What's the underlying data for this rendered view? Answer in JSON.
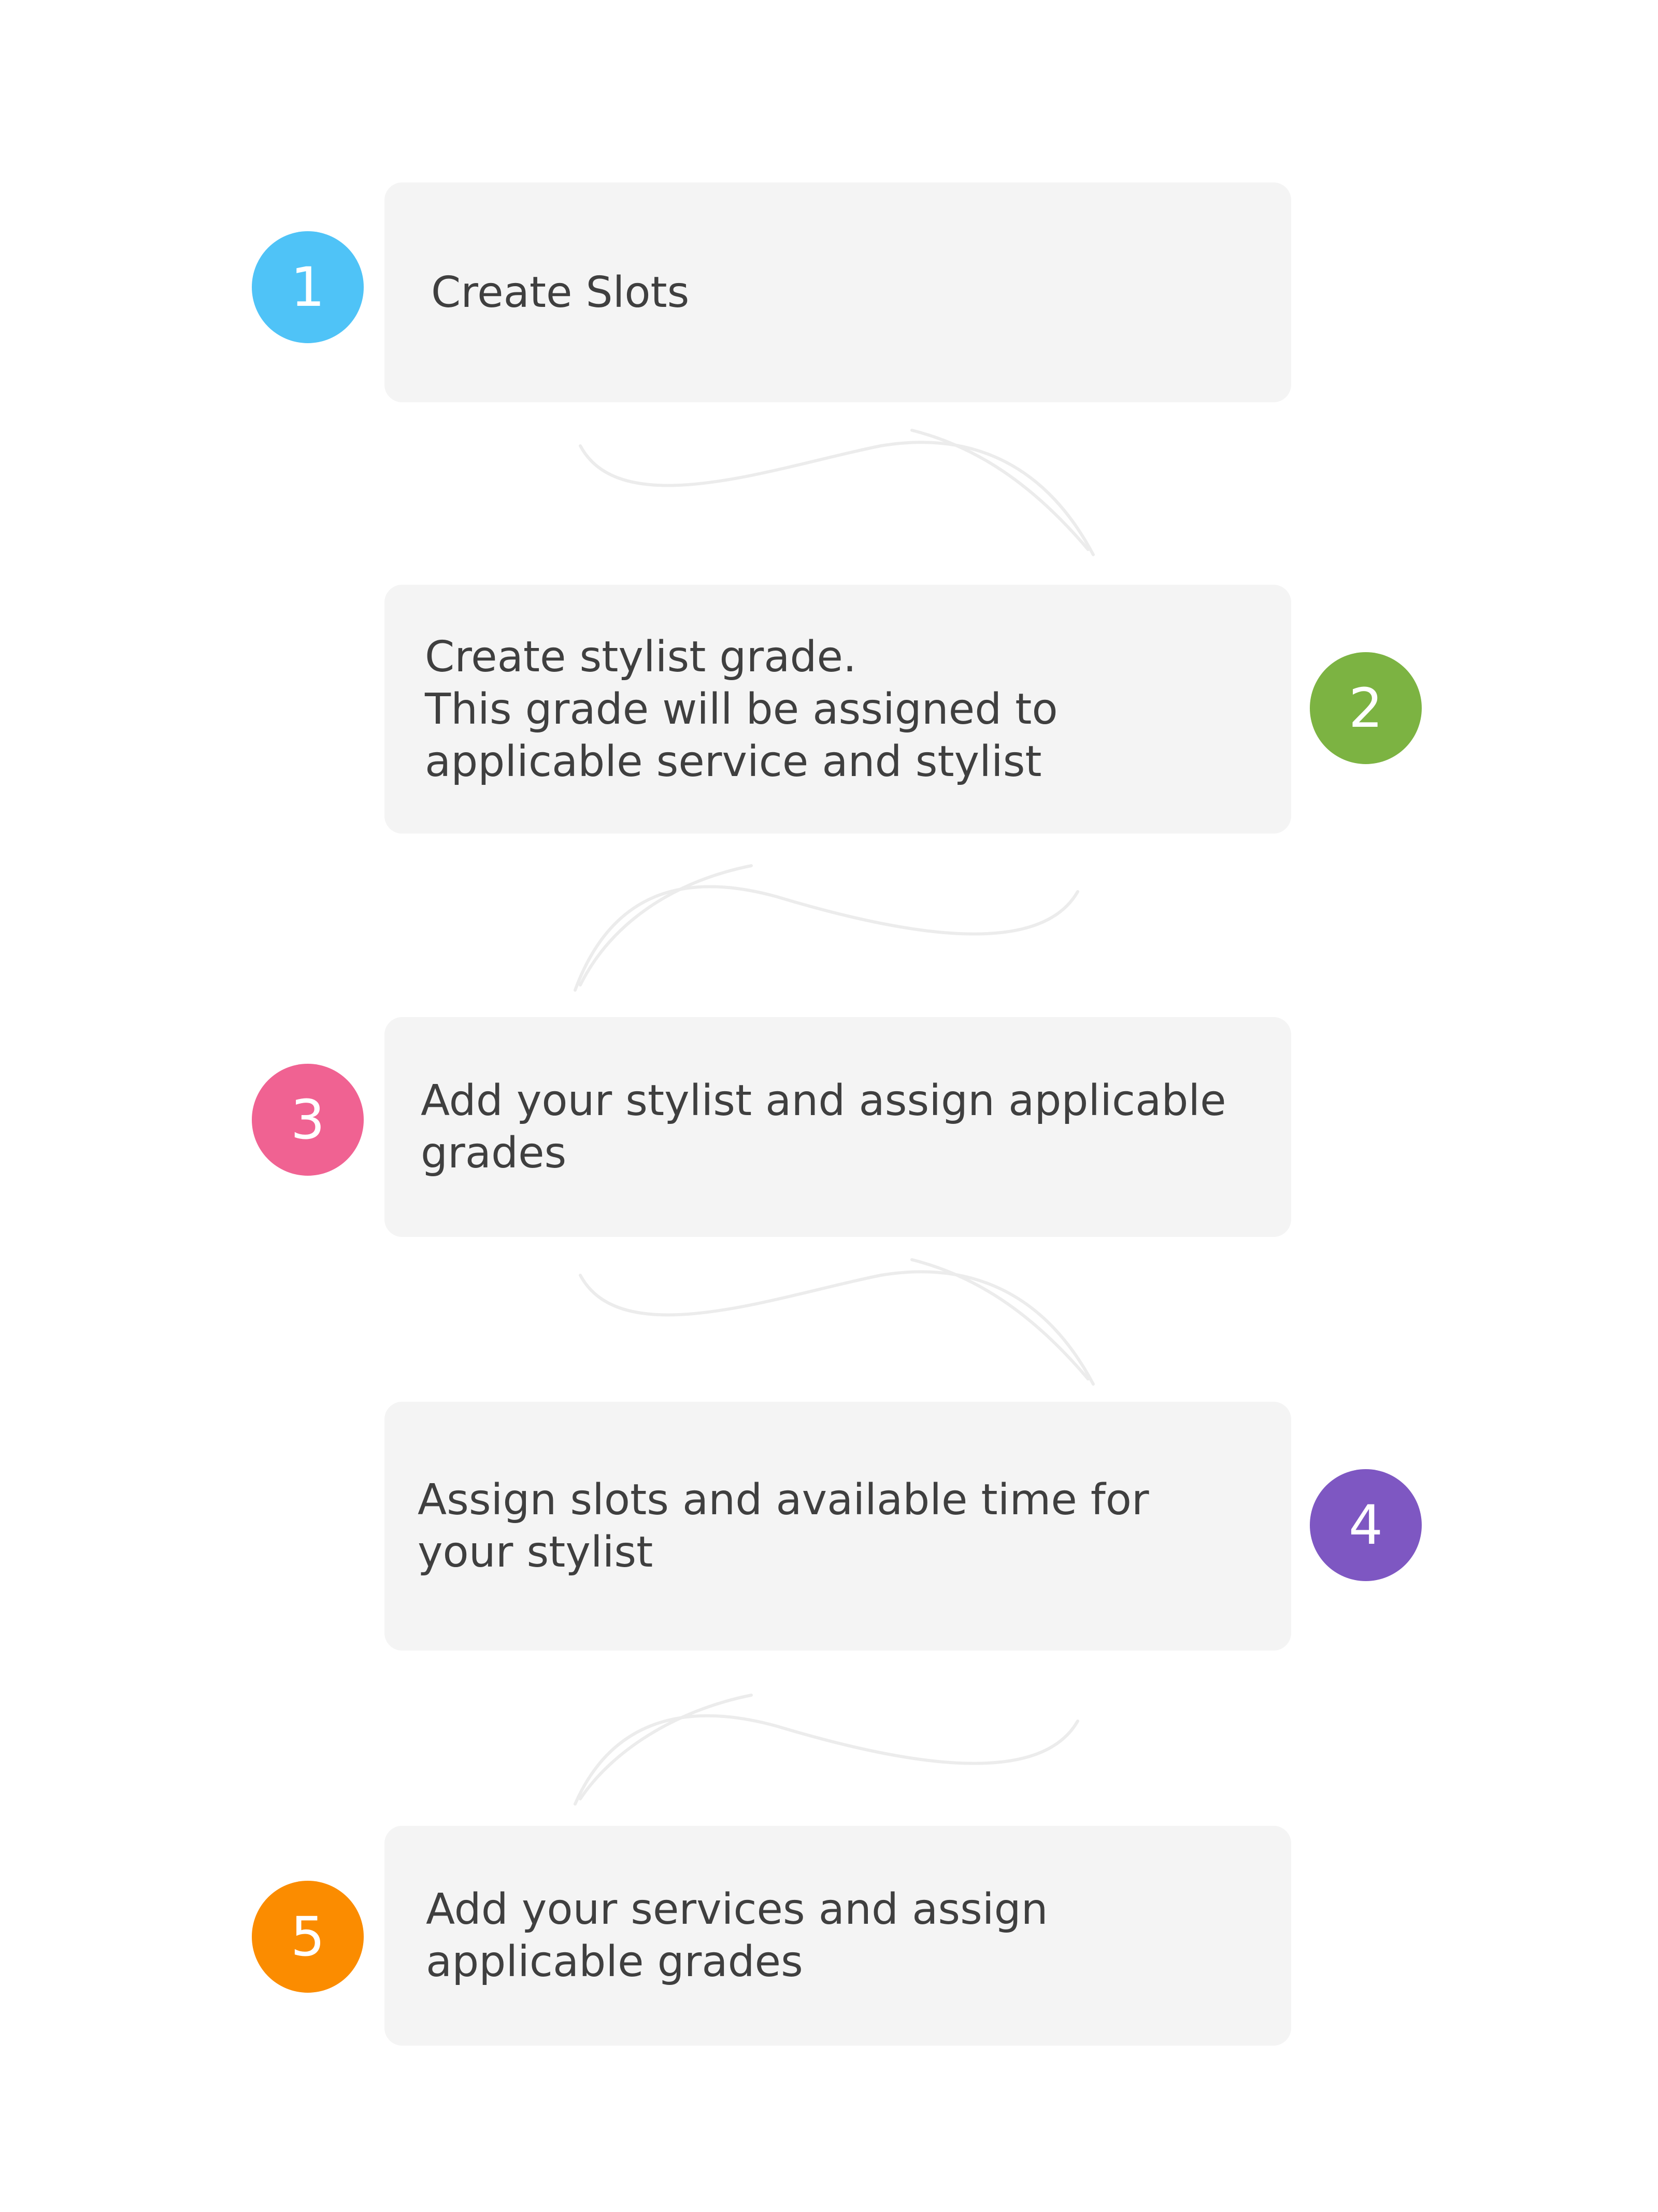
{
  "steps": [
    {
      "number": "1",
      "text": "Create Slots",
      "color": "#4fc3f7"
    },
    {
      "number": "2",
      "text": "Create stylist grade.\nThis grade will be assigned to applicable service and stylist",
      "color": "#7cb342"
    },
    {
      "number": "3",
      "text": "Add your stylist and assign applicable grades",
      "color": "#f06292"
    },
    {
      "number": "4",
      "text": "Assign slots and available time for your stylist",
      "color": "#7e57c2"
    },
    {
      "number": "5",
      "text": "Add your services and assign applicable grades",
      "color": "#fb8c00"
    }
  ]
}
